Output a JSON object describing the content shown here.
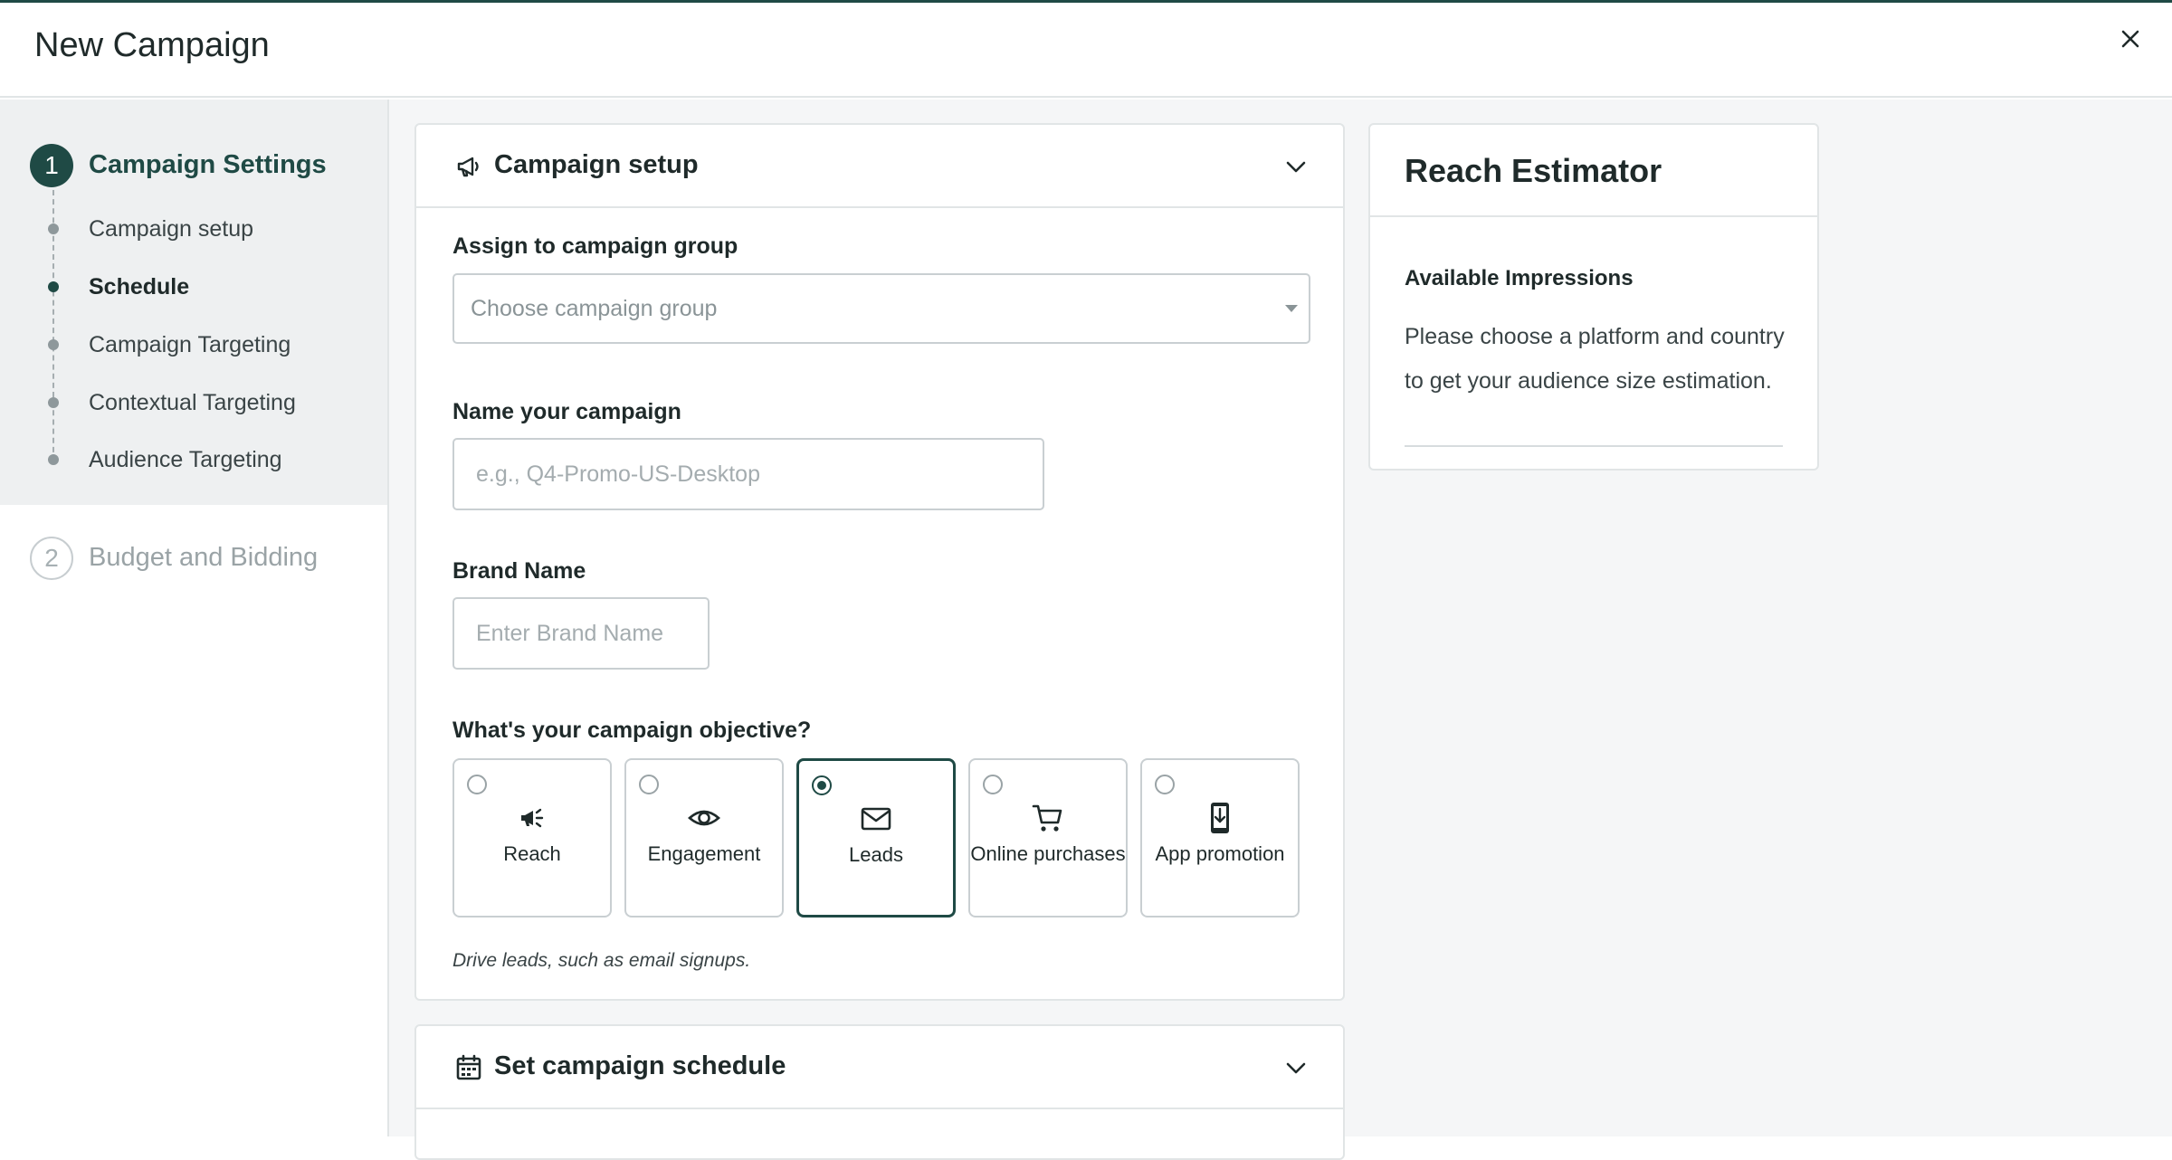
{
  "header": {
    "title": "New Campaign",
    "close_icon": "close-icon"
  },
  "sidebar": {
    "step1": {
      "number": "1",
      "title": "Campaign Settings"
    },
    "substeps": [
      {
        "label": "Campaign setup",
        "active": false
      },
      {
        "label": "Schedule",
        "active": true
      },
      {
        "label": "Campaign Targeting",
        "active": false
      },
      {
        "label": "Contextual Targeting",
        "active": false
      },
      {
        "label": "Audience Targeting",
        "active": false
      }
    ],
    "step2": {
      "number": "2",
      "title": "Budget and Bidding"
    }
  },
  "setup_card": {
    "title": "Campaign setup",
    "icon": "megaphone-icon",
    "group_label": "Assign to campaign group",
    "group_placeholder": "Choose campaign group",
    "name_label": "Name your campaign",
    "name_placeholder": "e.g., Q4-Promo-US-Desktop",
    "brand_label": "Brand Name",
    "brand_placeholder": "Enter Brand Name",
    "objective_label": "What's your campaign objective?",
    "objectives": [
      {
        "label": "Reach",
        "icon": "megaphone-icon",
        "selected": false
      },
      {
        "label": "Engagement",
        "icon": "eye-icon",
        "selected": false
      },
      {
        "label": "Leads",
        "icon": "envelope-icon",
        "selected": true
      },
      {
        "label": "Online purchases",
        "icon": "cart-icon",
        "selected": false
      },
      {
        "label": "App promotion",
        "icon": "phone-download-icon",
        "selected": false
      }
    ],
    "objective_help": "Drive leads, such as email signups."
  },
  "schedule_card": {
    "title": "Set campaign schedule",
    "icon": "calendar-icon"
  },
  "reach": {
    "title": "Reach Estimator",
    "subtitle": "Available Impressions",
    "text": "Please choose a platform and country to get your audience size estimation."
  },
  "colors": {
    "accent": "#1f4a45",
    "panel_bg": "#f5f6f7",
    "border": "#e1e5e6"
  }
}
